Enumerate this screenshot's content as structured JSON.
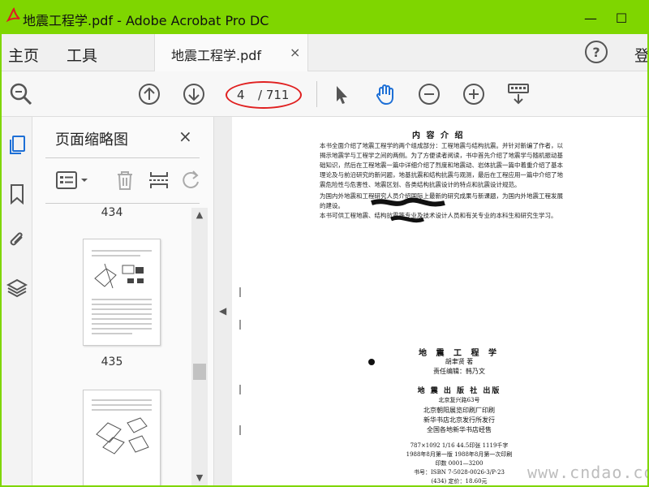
{
  "window": {
    "title": "地震工程学.pdf - Adobe Acrobat Pro DC",
    "minimize": "—",
    "maximize": "☐",
    "brand_color": "#7fd600"
  },
  "tabs": {
    "home": "主页",
    "tools": "工具",
    "doc_tab": "地震工程学.pdf",
    "doc_close": "×",
    "help": "?",
    "login": "登"
  },
  "toolbar": {
    "page_current": "4",
    "page_total": "/ 711",
    "icons": [
      "search-zoom-icon",
      "page-up-icon",
      "page-down-icon",
      "select-arrow-icon",
      "hand-tool-icon",
      "zoom-out-icon",
      "zoom-in-icon",
      "keyboard-icon"
    ]
  },
  "panel": {
    "title": "页面缩略图",
    "close": "×",
    "thumbs": [
      {
        "label": "434"
      },
      {
        "label": "435"
      }
    ]
  },
  "document": {
    "heading": "内 容 介 绍",
    "intro": "本书全面介绍了地震工程学的两个组成部分：工程地震与结构抗震。并针对新编了作者，以揭示地震学与工程学之间的两侧。为了方便读者阅读，书中首先介绍了地震学与随机振动基础知识，然后在工程地震一篇中详细介绍了烈度和地震动、岩体抗震一篇中着重介绍了基本理论及与前沿研究的新问题，地基抗震和结构抗震与观测，最后在工程应用一篇中介绍了地震危险性与危害性、地震区划、各类结构抗震设计的特点和抗震设计规范。",
    "p2": "为国内外地震和工程研究人员介绍国际上最新的研究成果与新课题，为国内外地震工程发展的建设。",
    "p3": "本书可供工程地震、结构抗震等专业及技术设计人员和有关专业的本科生和研究生学习。",
    "imprint_title": "地 震 工 程 学",
    "imprint_author": "胡聿贤 著",
    "imprint_editor": "责任编辑：韩乃文",
    "imprint_publisher": "地 震 出 版 社 出版",
    "imprint_address": "北京复兴路63号",
    "imprint_printer": "北京朝阳展览印刷厂印刷",
    "imprint_distributor": "新华书店北京发行所发行",
    "imprint_sellers": "全国各地新华书店经售",
    "imprint_format": "787×1092 1/16    44.5印张    1119千字",
    "imprint_edition": "1988年8月第一版    1988年8月第一次印刷",
    "imprint_print_run": "印数  0001—3200",
    "imprint_isbn": "书号：ISBN 7-5028-0026-3/P·23",
    "imprint_price": "(434)    定价：18.60元"
  },
  "watermark": "www.cndao.com"
}
